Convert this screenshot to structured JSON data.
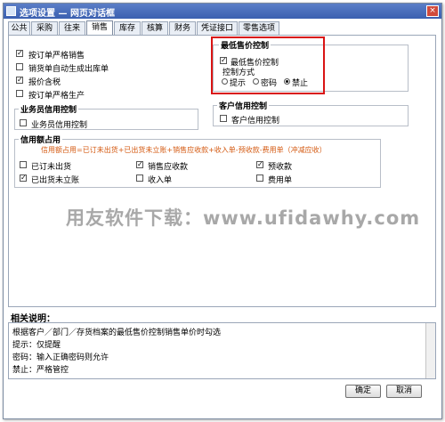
{
  "window": {
    "title": "选项设置 — 网页对话框",
    "close_glyph": "×"
  },
  "tabs": [
    "公共",
    "采购",
    "往来",
    "销售",
    "库存",
    "核算",
    "财务",
    "凭证接口",
    "零售选项"
  ],
  "active_tab_index": 3,
  "options_top": [
    {
      "label": "按订单严格销售",
      "checked": true
    },
    {
      "label": "销货单自动生成出库单",
      "checked": false
    },
    {
      "label": "报价含税",
      "checked": true
    },
    {
      "label": "按订单严格生产",
      "checked": false
    }
  ],
  "min_price_group": {
    "title": "最低售价控制",
    "checkbox_label": "最低售价控制",
    "checked": true,
    "method_label": "控制方式",
    "radios": [
      "提示",
      "密码",
      "禁止"
    ],
    "selected": "禁止"
  },
  "salesman_group": {
    "title": "业务员信用控制",
    "checkbox_label": "业务员信用控制",
    "checked": false
  },
  "customer_group": {
    "title": "客户信用控制",
    "checkbox_label": "客户信用控制",
    "checked": false
  },
  "credit_usage": {
    "title": "信用额占用",
    "formula": "信用额占用=已订未出货+已出货未立账+销售应收款+收入单-预收款-费用单（冲减应收）",
    "items": [
      {
        "label": "已订未出货",
        "checked": false
      },
      {
        "label": "销售应收款",
        "checked": true
      },
      {
        "label": "预收款",
        "checked": true
      },
      {
        "label": "已出货未立账",
        "checked": true
      },
      {
        "label": "收入单",
        "checked": false
      },
      {
        "label": "费用单",
        "checked": false
      }
    ]
  },
  "watermark": "用友软件下载：www.ufidawhy.com",
  "notes": {
    "title": "相关说明：",
    "lines": [
      "根据客户／部门／存货档案的最低售价控制销售单价时勾选",
      "提示：仅提醒",
      "密码：输入正确密码则允许",
      "禁止：严格管控"
    ]
  },
  "buttons": {
    "ok": "确定",
    "cancel": "取消"
  }
}
